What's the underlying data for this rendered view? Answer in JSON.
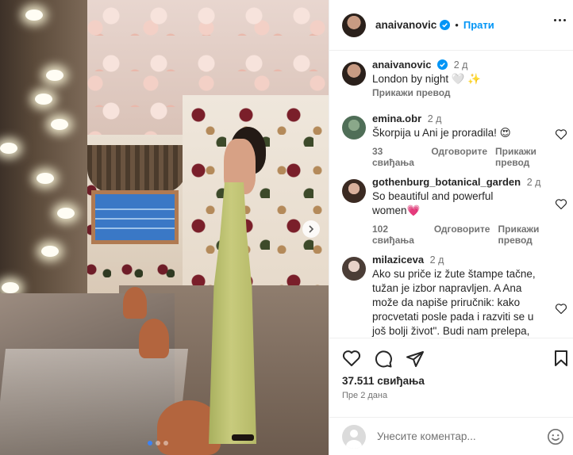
{
  "post": {
    "photo_alt": "",
    "carousel": {
      "count": 3,
      "active": 1
    }
  },
  "header": {
    "username": "anaivanovic",
    "separator": "•",
    "follow_label": "Прати"
  },
  "caption": {
    "username": "anaivanovic",
    "time": "2 д",
    "text": "London by night 🤍 ✨",
    "translate_label": "Прикажи превод"
  },
  "comments": [
    {
      "username": "emina.obr",
      "time": "2 д",
      "text": "Škorpija u Ani je proradila! 😍",
      "likes": "33 свиђања",
      "reply_label": "Одговорите",
      "translate_label": "Прикажи превод"
    },
    {
      "username": "gothenburg_botanical_garden",
      "time": "2 д",
      "text_line1": "So beautiful and powerful",
      "text_line2": "women💗",
      "likes": "102 свиђања",
      "reply_label": "Одговорите",
      "translate_label": "Прикажи превод"
    },
    {
      "username": "milaziceva",
      "time": "2 д",
      "lines": [
        "Ako su priče iz žute štampe tačne,",
        "tužan je izbor napravljen. A Ana",
        "može da napiše priručnik: kako",
        "procvetati posle pada i razviti se u",
        "još bolji život\". Budi nam prelepa,"
      ]
    }
  ],
  "actions": {
    "likes_count": "37.511 свиђања",
    "posted_ago": "Пре 2 дана"
  },
  "composer": {
    "placeholder": "Унесите коментар..."
  },
  "colors": {
    "link_blue": "#0095f6",
    "verified_blue": "#0095f6",
    "muted_text": "#737373",
    "text": "#262626"
  }
}
